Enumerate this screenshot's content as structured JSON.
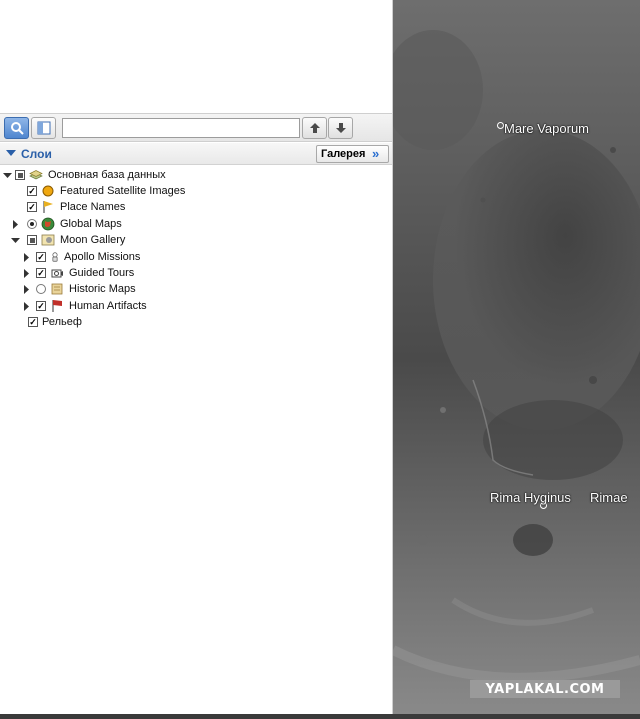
{
  "toolbar": {
    "search_value": "",
    "up_icon": "arrow-up-icon",
    "down_icon": "arrow-down-icon"
  },
  "layers": {
    "title": "Слои",
    "gallery_label": "Галерея",
    "gallery_chevron": "»"
  },
  "tree": {
    "primary_db": "Основная база данных",
    "featured_satellite": "Featured Satellite Images",
    "place_names": "Place Names",
    "global_maps": "Global Maps",
    "moon_gallery": "Moon Gallery",
    "apollo_missions": "Apollo Missions",
    "guided_tours": "Guided Tours",
    "historic_maps": "Historic Maps",
    "human_artifacts": "Human Artifacts",
    "relief": "Рельеф"
  },
  "map": {
    "label_1": "Mare Vaporum",
    "label_2": "Rima Hyginus",
    "label_3": "Rimae",
    "watermark": "YAPLAKAL.COM"
  },
  "colors": {
    "accent_blue": "#2a5fa8",
    "moon_dark": "#3c3c3c",
    "moon_light": "#8a8a8a"
  }
}
